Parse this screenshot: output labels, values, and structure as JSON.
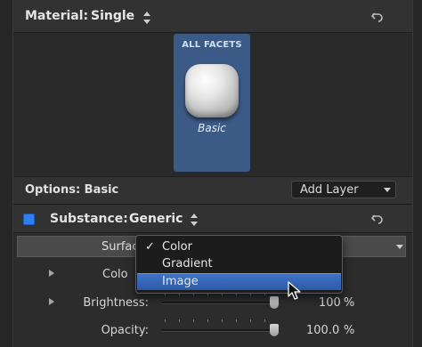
{
  "material": {
    "label": "Material:",
    "value": "Single"
  },
  "facet": {
    "title": "ALL FACETS",
    "name": "Basic"
  },
  "options": {
    "label": "Options: Basic",
    "add_layer": "Add Layer"
  },
  "substance": {
    "label": "Substance:",
    "value": "Generic",
    "enabled": true
  },
  "surface": {
    "label": "Surfac"
  },
  "params": [
    {
      "label": "Colo",
      "value": ""
    },
    {
      "label": "Brightness:",
      "value": "100",
      "unit": "%",
      "level": 1.0
    },
    {
      "label": "Opacity:",
      "value": "100.0",
      "unit": "%",
      "level": 1.0
    }
  ],
  "menu": {
    "items": [
      {
        "label": "Color",
        "checked": true,
        "highlighted": false
      },
      {
        "label": "Gradient",
        "checked": false,
        "highlighted": false
      },
      {
        "label": "Image",
        "checked": false,
        "highlighted": true
      }
    ],
    "check_glyph": "✓"
  },
  "colors": {
    "accent": "#2f7ff0",
    "facet_bg": "#3c5a86",
    "menu_highlight": "#3a6bbb"
  },
  "icons": {
    "reset": "reset-arrow-icon",
    "stepper": "up-down-stepper-icon",
    "disclosure": "disclosure-triangle-icon",
    "cursor": "mouse-pointer-icon"
  }
}
